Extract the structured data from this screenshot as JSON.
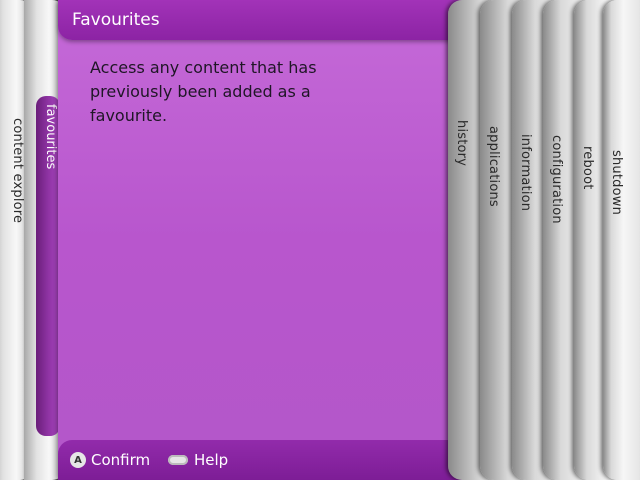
{
  "panel": {
    "title": "Favourites",
    "description": "Access any content that has previously been added as a favourite."
  },
  "left_tabs": [
    {
      "label": "content explore"
    },
    {
      "label": "favourites"
    }
  ],
  "right_tabs": [
    {
      "label": "history"
    },
    {
      "label": "applications"
    },
    {
      "label": "information"
    },
    {
      "label": "configuration"
    },
    {
      "label": "reboot"
    },
    {
      "label": "shutdown"
    }
  ],
  "footer": {
    "confirm_icon_letter": "A",
    "confirm_label": "Confirm",
    "help_label": "Help"
  },
  "colors": {
    "accent": "#a233b8",
    "panel": "#b856cd",
    "blade": "#e8e8e8"
  }
}
